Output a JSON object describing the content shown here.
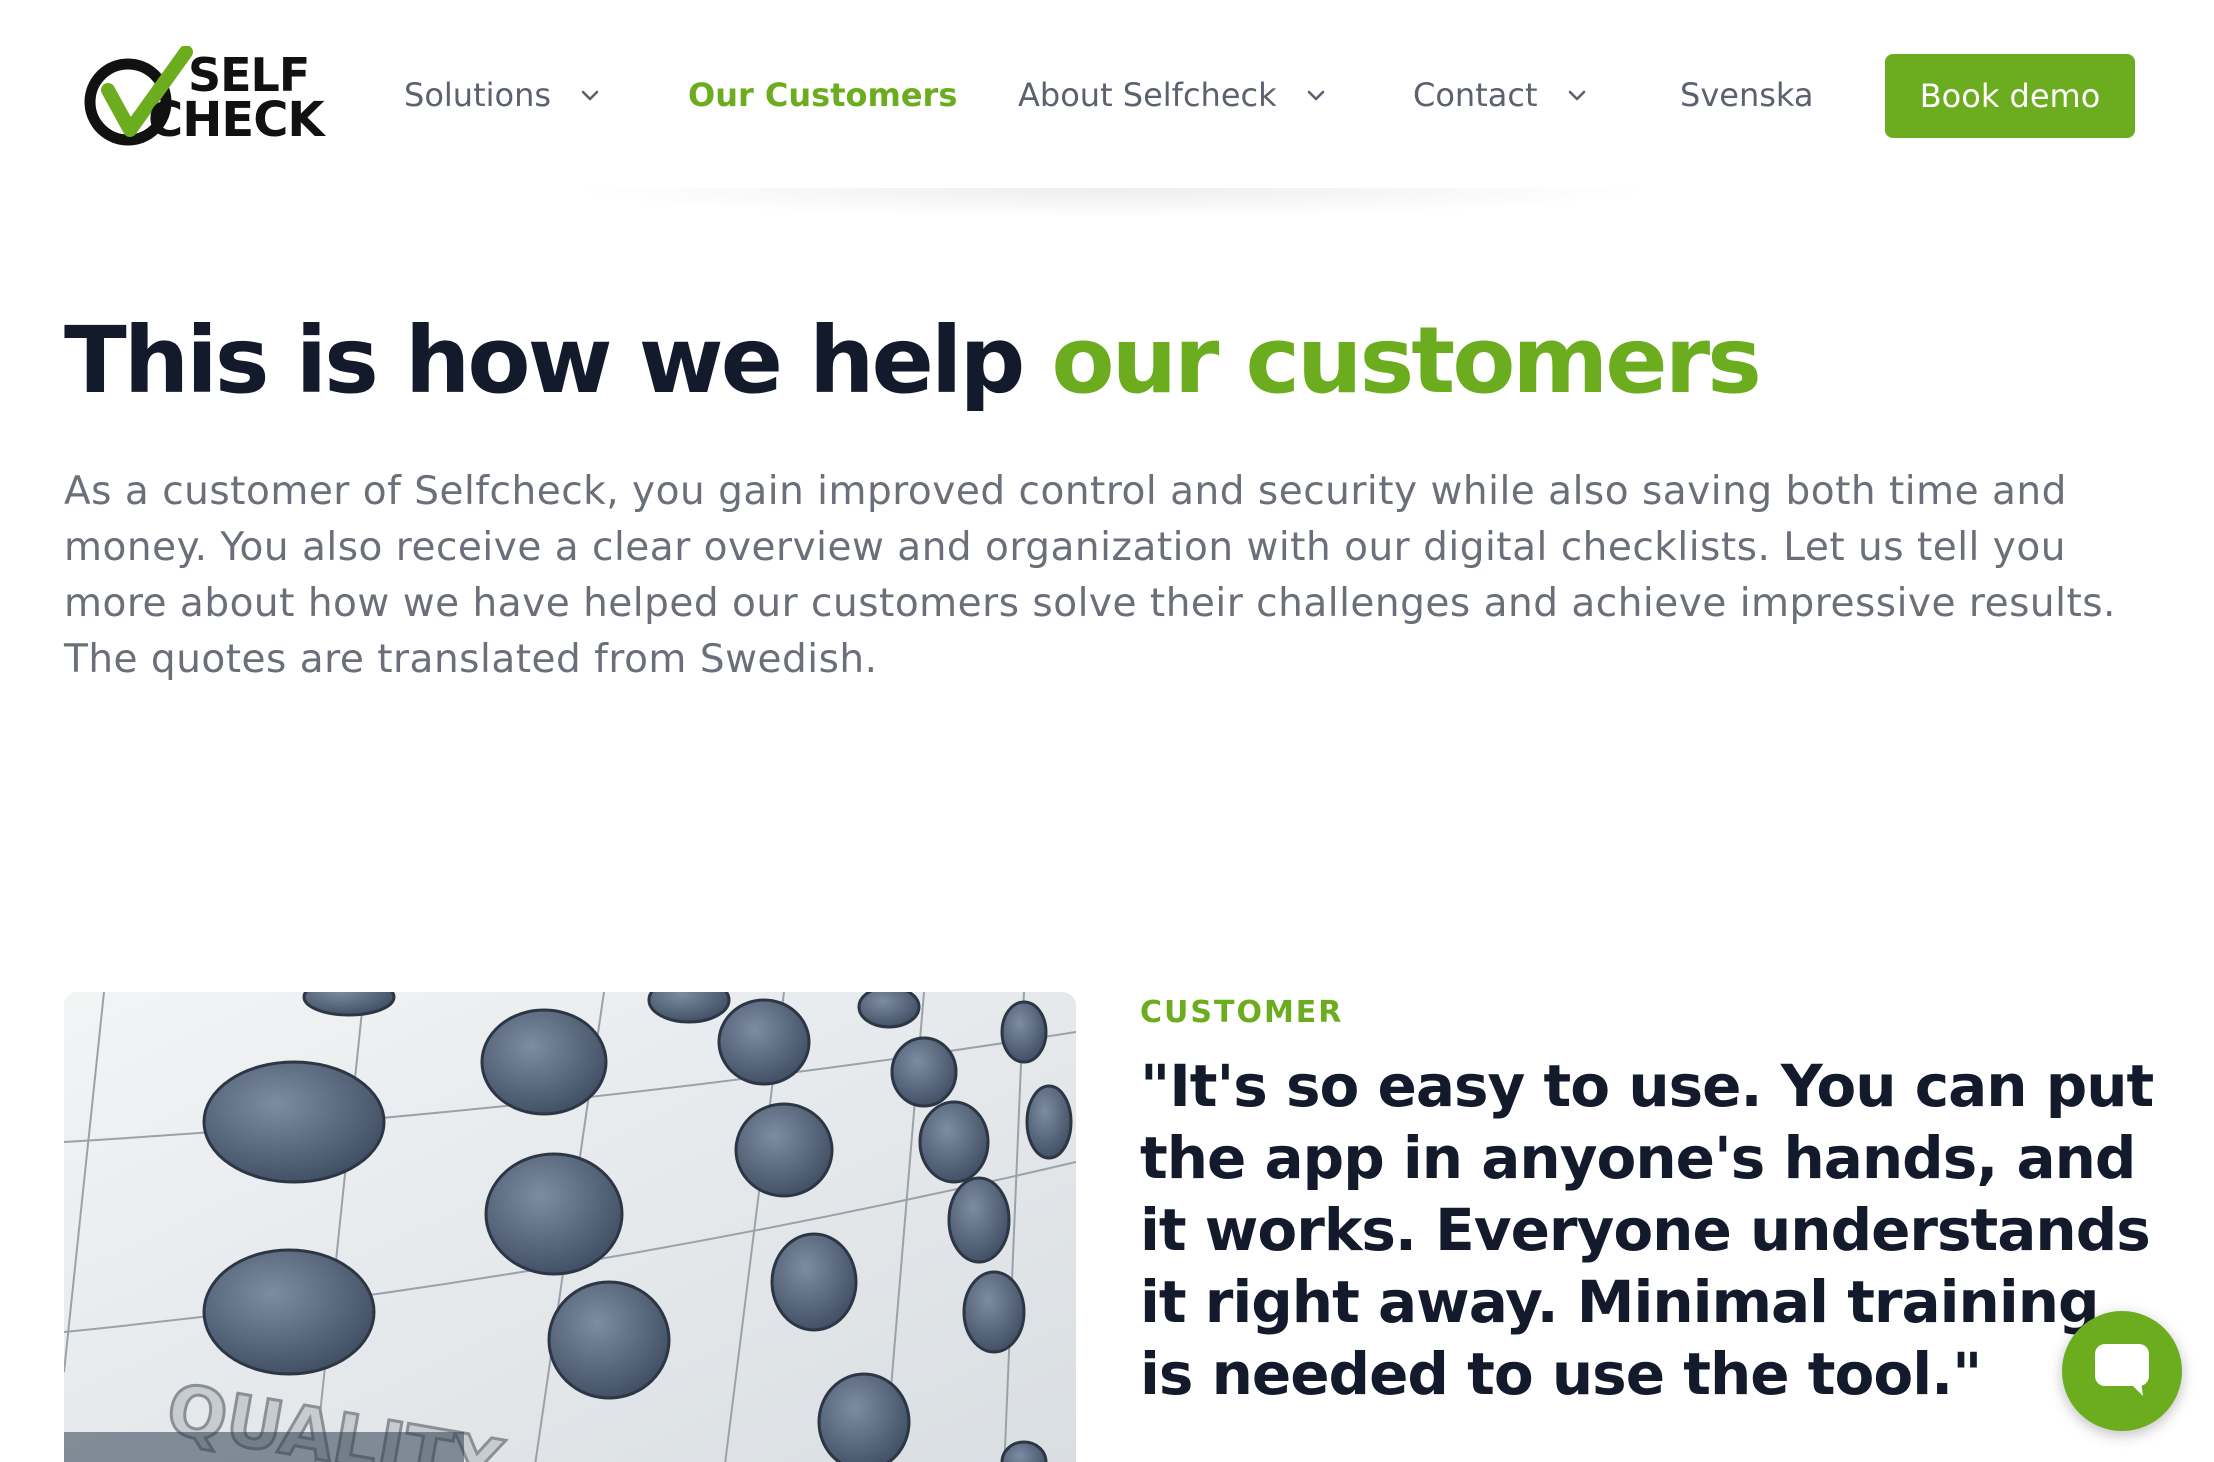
{
  "brand": {
    "logo_line1": "SELF",
    "logo_line2": "CHECK",
    "accent_color": "#6bad1e",
    "dark_color": "#121a2b"
  },
  "nav": {
    "items": [
      {
        "label": "Solutions",
        "has_dropdown": true,
        "icon": "chevron-down-icon"
      },
      {
        "label": "Our Customers",
        "has_dropdown": false,
        "active": true
      },
      {
        "label": "About Selfcheck",
        "has_dropdown": true,
        "icon": "chevron-down-icon"
      },
      {
        "label": "Contact",
        "has_dropdown": true,
        "icon": "chevron-down-icon"
      }
    ],
    "language": "Svenska",
    "cta": "Book demo"
  },
  "hero": {
    "title_main": "This is how we help ",
    "title_accent": "our customers",
    "body": "As a customer of Selfcheck, you gain improved control and security while also saving both time and money. You also receive a clear overview and organization with our digital checklists. Let us tell you more about how we have helped our customers solve their challenges and achieve impressive results. The quotes are translated from Swedish."
  },
  "customer": {
    "label": "CUSTOMER",
    "quote": "\"It's so easy to use. You can put the app in anyone's hands, and it works. Everyone understands it right away. Minimal training is needed to use the tool.\"",
    "photo_icon": "building-facade-photo"
  },
  "chat": {
    "icon": "chat-bubble-icon"
  }
}
